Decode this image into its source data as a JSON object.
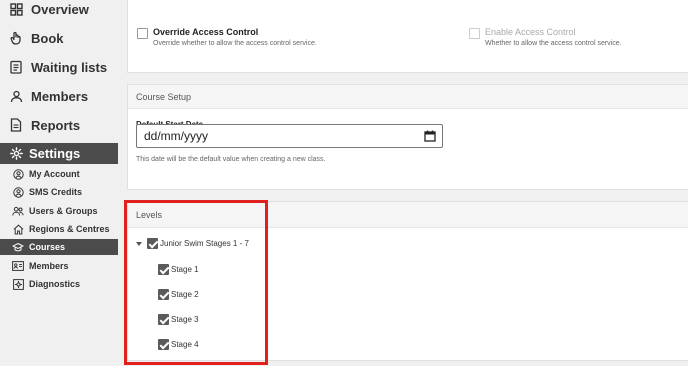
{
  "sidebar": {
    "main_items": [
      {
        "label": "Overview"
      },
      {
        "label": "Book"
      },
      {
        "label": "Waiting lists"
      },
      {
        "label": "Members"
      },
      {
        "label": "Reports"
      }
    ],
    "settings_label": "Settings",
    "sub_items": [
      {
        "label": "My Account"
      },
      {
        "label": "SMS Credits"
      },
      {
        "label": "Users & Groups"
      },
      {
        "label": "Regions & Centres"
      },
      {
        "label": "Courses",
        "active": true
      },
      {
        "label": "Members"
      },
      {
        "label": "Diagnostics"
      }
    ]
  },
  "access": {
    "override_title": "Override Access Control",
    "override_desc": "Override whether to allow the access control service.",
    "enable_title": "Enable Access Control",
    "enable_desc": "Whether to allow the access control service."
  },
  "course_setup": {
    "title": "Course Setup",
    "field_label": "Default Start Date",
    "placeholder": "dd/mm/yyyy",
    "hint": "This date will be the default value when creating a new class."
  },
  "levels": {
    "title": "Levels",
    "parent": "Junior Swim Stages 1 - 7",
    "children": [
      "Stage 1",
      "Stage 2",
      "Stage 3",
      "Stage 4"
    ]
  },
  "colors": {
    "accent_dark": "#4b4b4b",
    "highlight_red": "#e0201c"
  }
}
